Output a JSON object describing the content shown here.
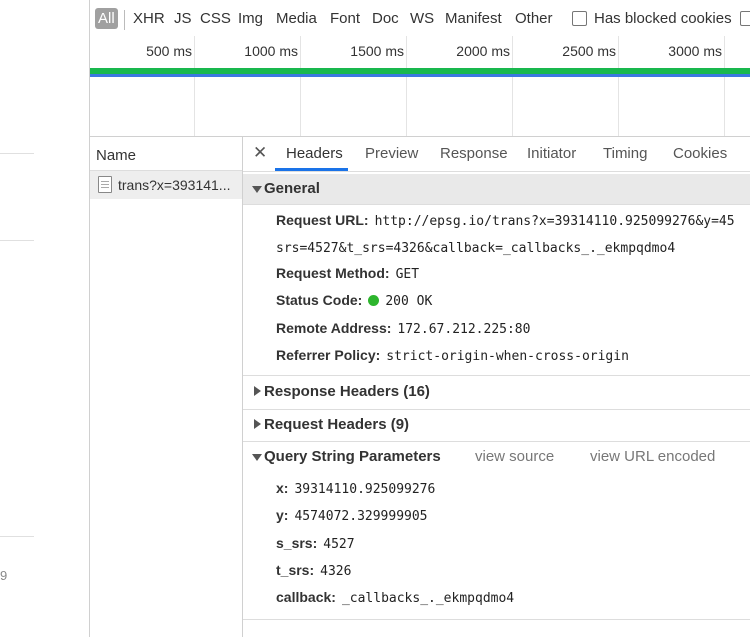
{
  "filters": {
    "items": [
      "All",
      "XHR",
      "JS",
      "CSS",
      "Img",
      "Media",
      "Font",
      "Doc",
      "WS",
      "Manifest",
      "Other"
    ],
    "has_blocked_cookies": "Has blocked cookies"
  },
  "timeline": {
    "ticks": [
      "500 ms",
      "1000 ms",
      "1500 ms",
      "2000 ms",
      "2500 ms",
      "3000 ms"
    ]
  },
  "left_strip": {
    "fragment": "9"
  },
  "requests": {
    "header": "Name",
    "items": [
      {
        "name": "trans?x=393141..."
      }
    ]
  },
  "detail": {
    "tabs": [
      "Headers",
      "Preview",
      "Response",
      "Initiator",
      "Timing",
      "Cookies"
    ],
    "active_tab": "Headers",
    "general": {
      "title": "General",
      "request_url_label": "Request URL:",
      "request_url_line1": "http://epsg.io/trans?x=39314110.925099276&y=45",
      "request_url_line2": "srs=4527&t_srs=4326&callback=_callbacks_._ekmpqdmo4",
      "request_method_label": "Request Method:",
      "request_method": "GET",
      "status_code_label": "Status Code:",
      "status_code": "200 OK",
      "status_color": "#2db52d",
      "remote_address_label": "Remote Address:",
      "remote_address": "172.67.212.225:80",
      "referrer_policy_label": "Referrer Policy:",
      "referrer_policy": "strict-origin-when-cross-origin"
    },
    "response_headers": "Response Headers (16)",
    "request_headers": "Request Headers (9)",
    "query": {
      "title": "Query String Parameters",
      "view_source": "view source",
      "view_url_encoded": "view URL encoded",
      "params": [
        {
          "key": "x:",
          "value": "39314110.925099276"
        },
        {
          "key": "y:",
          "value": "4574072.329999905"
        },
        {
          "key": "s_srs:",
          "value": "4527"
        },
        {
          "key": "t_srs:",
          "value": "4326"
        },
        {
          "key": "callback:",
          "value": "_callbacks_._ekmpqdmo4"
        }
      ]
    }
  }
}
